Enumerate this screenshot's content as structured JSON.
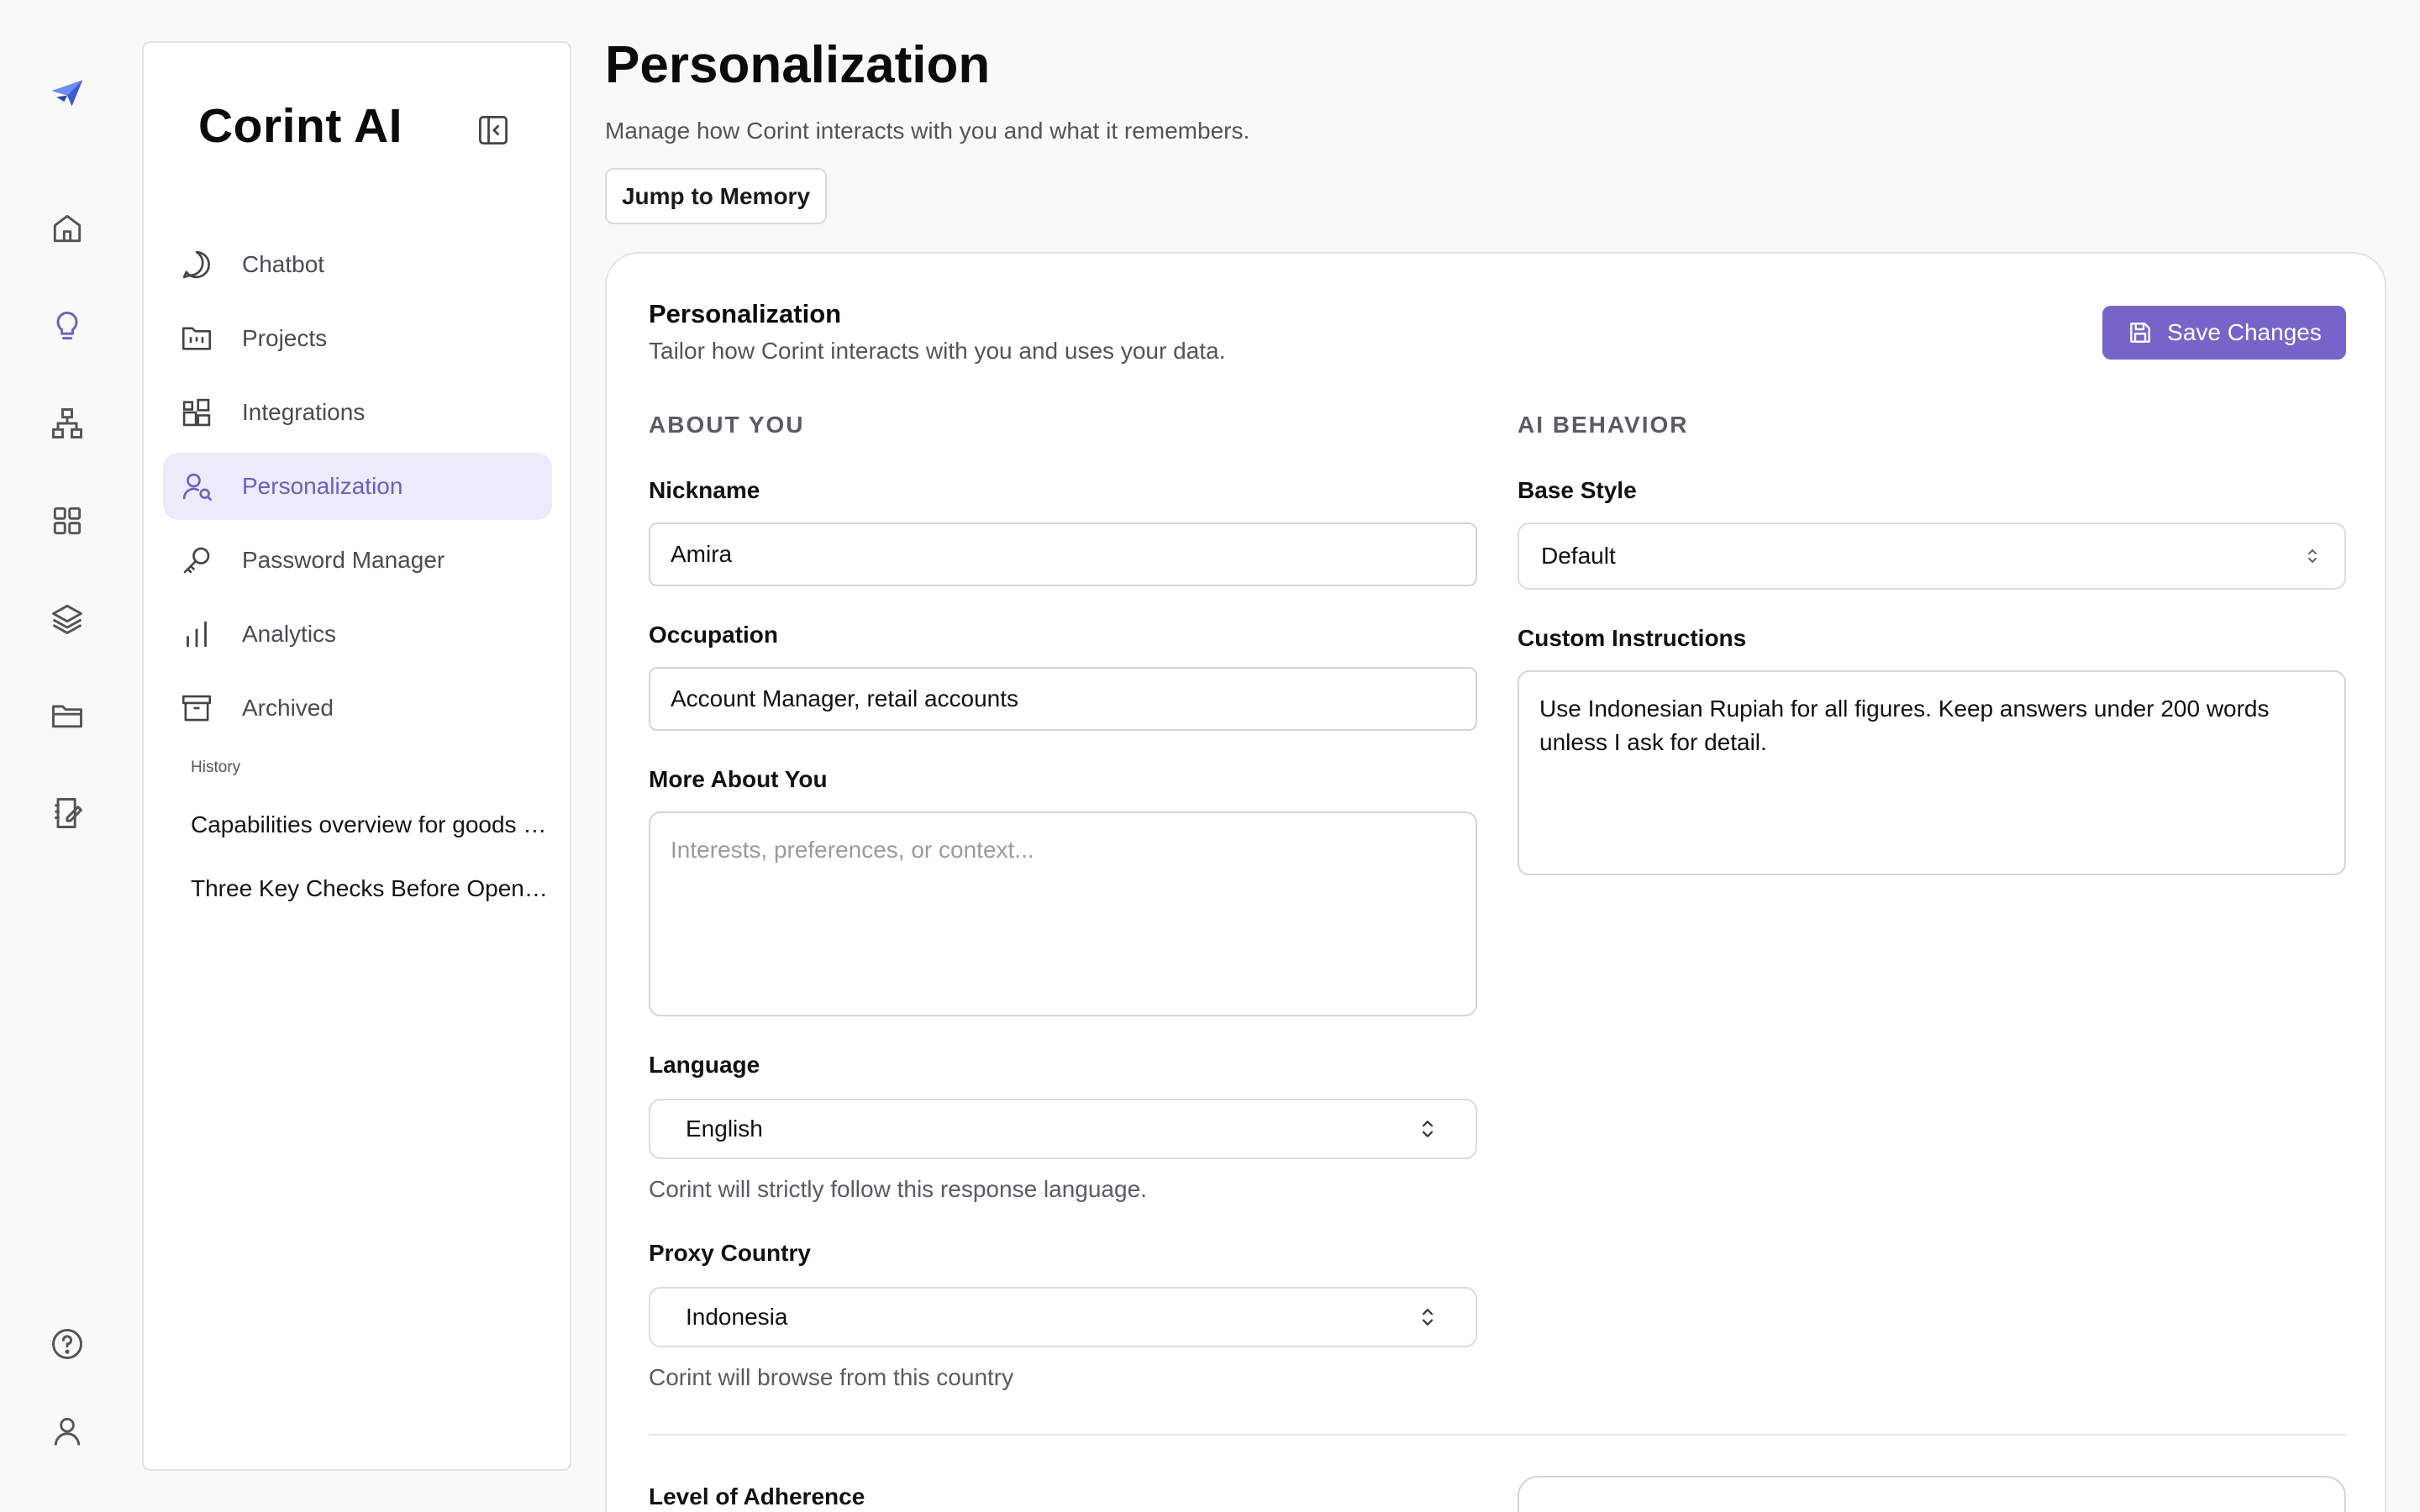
{
  "sidebar": {
    "brand": "Corint AI",
    "nav": [
      {
        "label": "Chatbot",
        "icon": "chat-bubble-icon"
      },
      {
        "label": "Projects",
        "icon": "project-folder-icon"
      },
      {
        "label": "Integrations",
        "icon": "integrations-icon"
      },
      {
        "label": "Personalization",
        "icon": "user-search-icon",
        "active": true
      },
      {
        "label": "Password Manager",
        "icon": "key-icon"
      },
      {
        "label": "Analytics",
        "icon": "bar-chart-icon"
      },
      {
        "label": "Archived",
        "icon": "archive-icon"
      }
    ],
    "history_title": "History",
    "history": [
      "Capabilities overview for goods and services",
      "Three Key Checks Before Opening an Account"
    ]
  },
  "page": {
    "title": "Personalization",
    "subtitle": "Manage how Corint interacts with you and what it remembers.",
    "jump_label": "Jump to Memory"
  },
  "card": {
    "title": "Personalization",
    "subtitle": "Tailor how Corint interacts with you and uses your data.",
    "save_label": "Save Changes",
    "about": {
      "heading": "ABOUT YOU",
      "nickname_label": "Nickname",
      "nickname_value": "Amira",
      "occupation_label": "Occupation",
      "occupation_value": "Account Manager, retail accounts",
      "more_label": "More About You",
      "more_placeholder": "Interests, preferences, or context...",
      "language_label": "Language",
      "language_value": "English",
      "language_help": "Corint will strictly follow this response language.",
      "proxy_label": "Proxy Country",
      "proxy_value": "Indonesia",
      "proxy_help": "Corint will browse from this country"
    },
    "ai": {
      "heading": "AI BEHAVIOR",
      "style_label": "Base Style",
      "style_value": "Default",
      "instructions_label": "Custom Instructions",
      "instructions_value": "Use Indonesian Rupiah for all figures. Keep answers under 200 words unless I ask for detail."
    },
    "adherence_label": "Level of Adherence"
  },
  "colors": {
    "accent": "#7764c9",
    "active_bg": "#ecebfb",
    "active_text": "#6b5fc5",
    "logo": "#3b5bd6"
  }
}
